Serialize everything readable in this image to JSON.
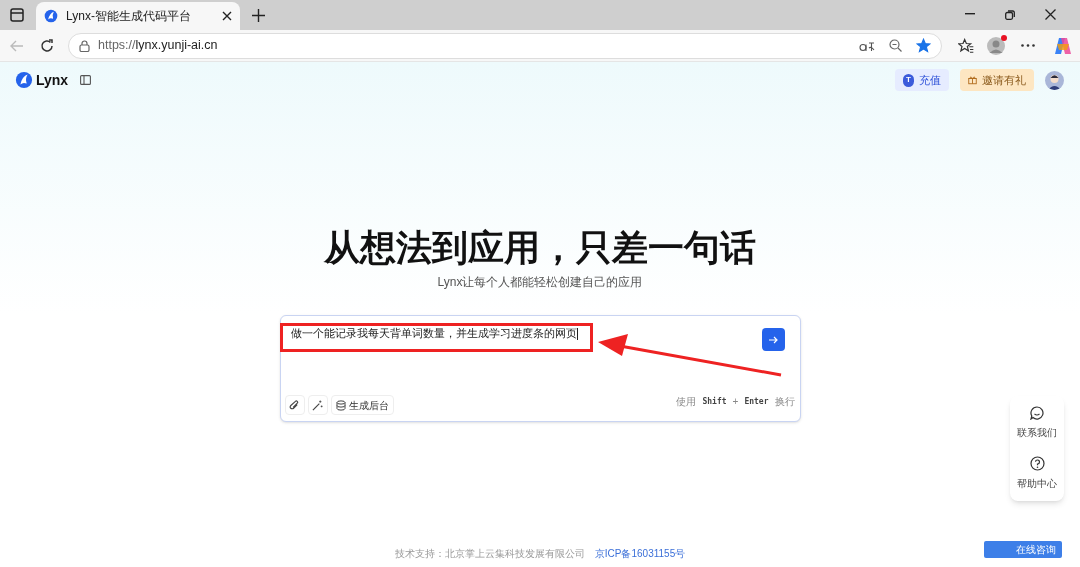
{
  "browser": {
    "tab_title": "Lynx-智能生成代码平台",
    "url_prefix": "https://",
    "url_host": "lynx.yunji-ai.cn",
    "favorite": true,
    "profile_notification": true
  },
  "header": {
    "logo": "Lynx",
    "buttons": [
      {
        "kind": "recharge",
        "label": "充值",
        "icon_letter": "T"
      },
      {
        "kind": "invite",
        "label": "邀请有礼"
      }
    ]
  },
  "hero": {
    "title": "从想法到应用，只差一句话",
    "subtitle": "Lynx让每个人都能轻松创建自己的应用"
  },
  "prompt": {
    "value": "做一个能记录我每天背单词数量，并生成学习进度条的网页",
    "highlighted": true,
    "tools": [
      {
        "kind": "attach"
      },
      {
        "kind": "magic"
      },
      {
        "kind": "backend",
        "label": "生成后台"
      }
    ],
    "hint": [
      {
        "kind": "text",
        "text": "使用"
      },
      {
        "kind": "key",
        "text": "Shift"
      },
      {
        "kind": "text",
        "text": "+"
      },
      {
        "kind": "key",
        "text": "Enter"
      },
      {
        "kind": "text",
        "text": "换行"
      }
    ]
  },
  "float_panel": [
    {
      "kind": "chat",
      "label": "联系我们"
    },
    {
      "kind": "help",
      "label": "帮助中心"
    }
  ],
  "chat_button": "在线咨询",
  "footer": {
    "support": "技术支持：北京掌上云集科技发展有限公司",
    "icp": "京ICP备16031155号"
  }
}
